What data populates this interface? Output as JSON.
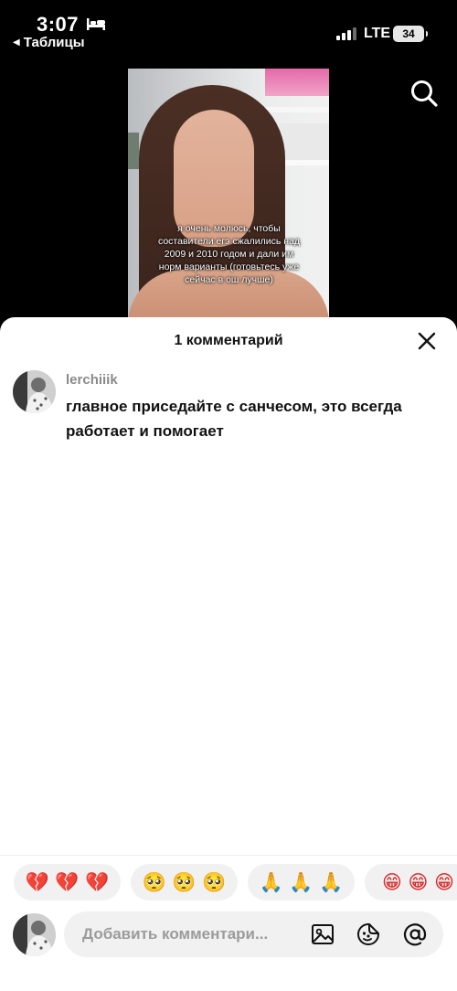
{
  "status_bar": {
    "time": "3:07",
    "back_label": "Таблицы",
    "network": "LTE",
    "battery": "34"
  },
  "video": {
    "caption": "я очень молюсь, чтобы составители егэ сжалились над 2009 и 2010 годом и дали им норм варианты (готовьтесь уже сейчас в ош лучше)"
  },
  "sheet": {
    "title": "1 комментарий",
    "comments": [
      {
        "username": "lerchiiik",
        "text": "главное приседайте с санчесом, это всегда работает и помогает"
      }
    ],
    "quick_emojis": [
      "💔 💔 💔",
      "🥺 🥺 🥺",
      "🙏 🙏 🙏",
      "😁 😁 😁"
    ],
    "input": {
      "placeholder": "Добавить комментари..."
    }
  },
  "icons": {
    "search": "search-icon",
    "close": "close-icon",
    "image": "image-icon",
    "emoji": "emoji-icon",
    "mention": "mention-icon"
  }
}
